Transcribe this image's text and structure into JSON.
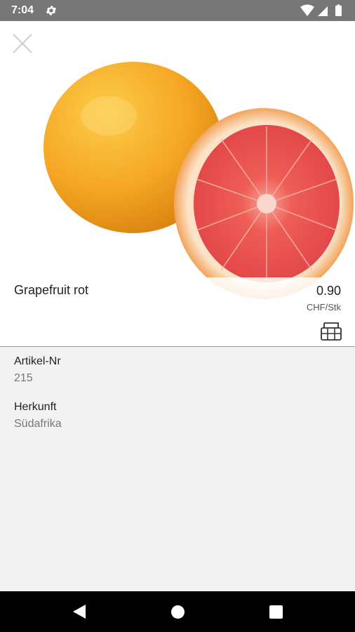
{
  "status_bar": {
    "time": "7:04",
    "icons": [
      "gear-icon",
      "wifi-icon",
      "signal-icon",
      "battery-icon"
    ]
  },
  "product": {
    "name": "Grapefruit rot",
    "price": "0.90",
    "unit": "CHF/Stk",
    "image": "grapefruit-image"
  },
  "details": [
    {
      "label": "Artikel-Nr",
      "value": "215"
    },
    {
      "label": "Herkunft",
      "value": "Südafrika"
    }
  ],
  "colors": {
    "status_bar": "#767676",
    "details_background": "#f2f2f2",
    "nav_bar": "#000000",
    "grapefruit_peel": "#f3a826",
    "grapefruit_flesh": "#ef5a55"
  },
  "nav_bar": {
    "icons": [
      "back-icon",
      "home-icon",
      "recent-apps-icon"
    ]
  }
}
